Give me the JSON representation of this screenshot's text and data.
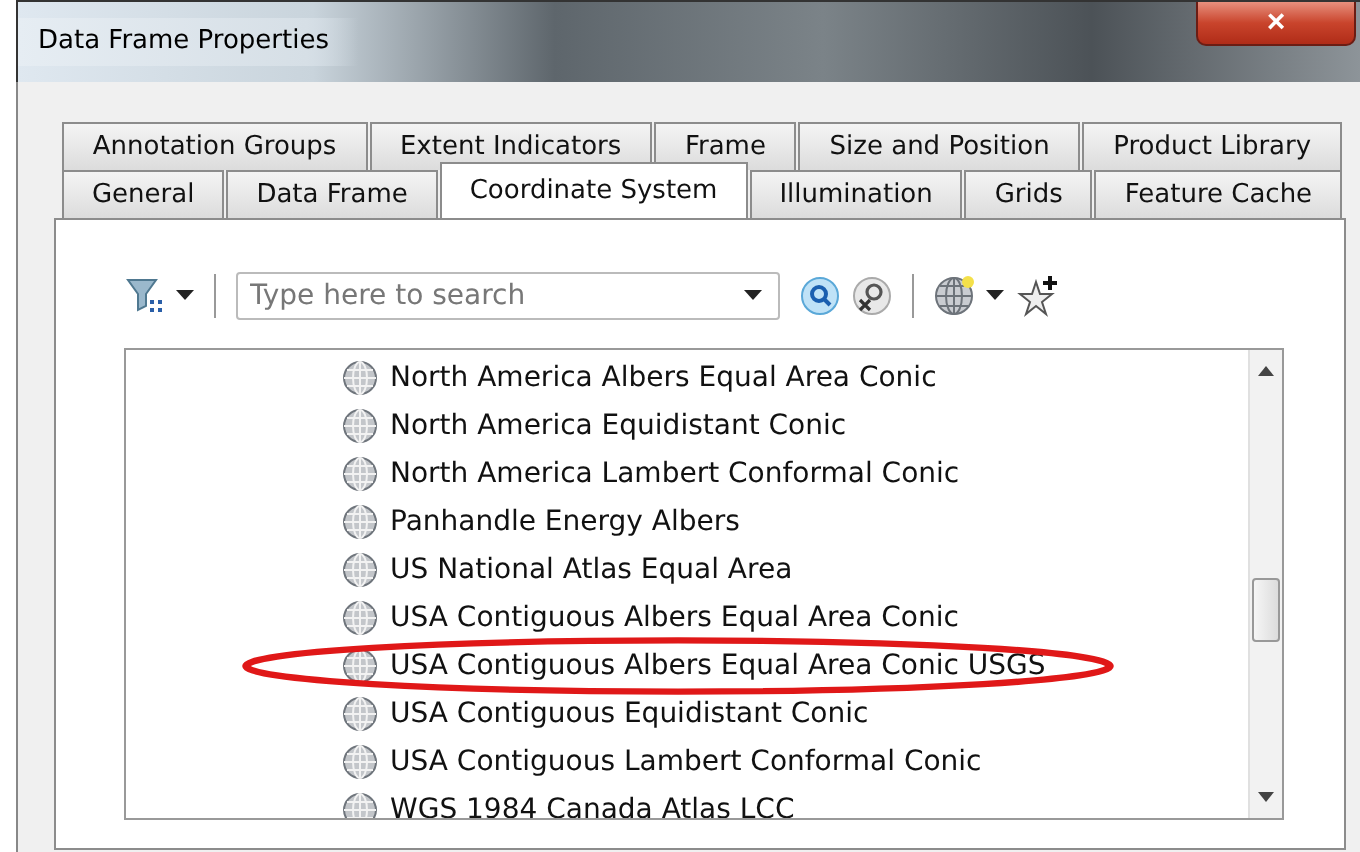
{
  "window": {
    "title": "Data Frame Properties",
    "close": "×"
  },
  "tab_rows": [
    {
      "tabs": [
        {
          "label": "Annotation Groups",
          "selected": false
        },
        {
          "label": "Extent Indicators",
          "selected": false
        },
        {
          "label": "Frame",
          "selected": false
        },
        {
          "label": "Size and Position",
          "selected": false
        },
        {
          "label": "Product Library",
          "selected": false
        }
      ]
    },
    {
      "tabs": [
        {
          "label": "General",
          "selected": false
        },
        {
          "label": "Data Frame",
          "selected": false
        },
        {
          "label": "Coordinate System",
          "selected": true
        },
        {
          "label": "Illumination",
          "selected": false
        },
        {
          "label": "Grids",
          "selected": false
        },
        {
          "label": "Feature Cache",
          "selected": false
        }
      ]
    }
  ],
  "search": {
    "placeholder": "Type here to search"
  },
  "list": {
    "items": [
      {
        "label": "North America Albers Equal Area Conic",
        "circled": false
      },
      {
        "label": "North America Equidistant Conic",
        "circled": false
      },
      {
        "label": "North America Lambert Conformal Conic",
        "circled": false
      },
      {
        "label": "Panhandle Energy Albers",
        "circled": false
      },
      {
        "label": "US National Atlas Equal Area",
        "circled": false
      },
      {
        "label": "USA Contiguous Albers Equal Area Conic",
        "circled": false
      },
      {
        "label": "USA Contiguous Albers Equal Area Conic USGS",
        "circled": true
      },
      {
        "label": "USA Contiguous Equidistant Conic",
        "circled": false
      },
      {
        "label": "USA Contiguous Lambert Conformal Conic",
        "circled": false
      },
      {
        "label": "WGS 1984 Canada Atlas LCC",
        "circled": false
      }
    ]
  }
}
